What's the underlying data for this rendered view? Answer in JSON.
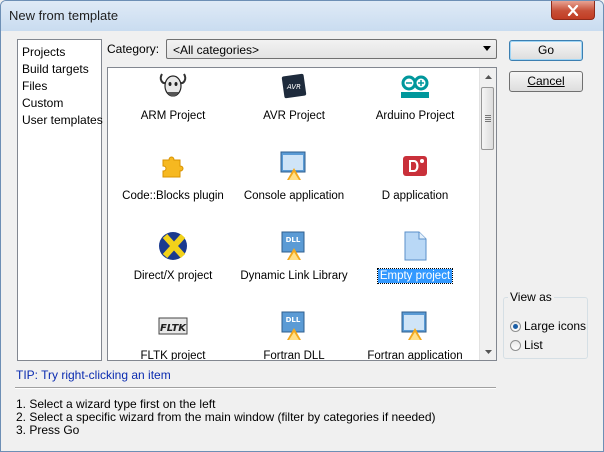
{
  "window": {
    "title": "New from template",
    "close_label": "×"
  },
  "sidebar": {
    "items": [
      {
        "label": "Projects"
      },
      {
        "label": "Build targets"
      },
      {
        "label": "Files"
      },
      {
        "label": "Custom"
      },
      {
        "label": "User templates"
      }
    ]
  },
  "category": {
    "label": "Category:",
    "value": "<All categories>"
  },
  "templates": [
    {
      "label": "ARM Project",
      "icon": "gnu-icon"
    },
    {
      "label": "AVR Project",
      "icon": "avr-chip-icon"
    },
    {
      "label": "Arduino Project",
      "icon": "arduino-icon"
    },
    {
      "label": "Code::Blocks plugin",
      "icon": "puzzle-icon"
    },
    {
      "label": "Console application",
      "icon": "console-app-icon"
    },
    {
      "label": "D application",
      "icon": "d-app-icon"
    },
    {
      "label": "Direct/X project",
      "icon": "directx-icon"
    },
    {
      "label": "Dynamic Link Library",
      "icon": "dll-icon"
    },
    {
      "label": "Empty project",
      "icon": "empty-file-icon",
      "selected": true
    },
    {
      "label": "FLTK project",
      "icon": "fltk-icon"
    },
    {
      "label": "Fortran DLL",
      "icon": "fortran-dll-icon"
    },
    {
      "label": "Fortran application",
      "icon": "fortran-app-icon"
    }
  ],
  "buttons": {
    "go": "Go",
    "cancel": "Cancel"
  },
  "view_as": {
    "title": "View as",
    "large_icons": "Large icons",
    "list": "List",
    "selected": "large_icons"
  },
  "tip": "TIP: Try right-clicking an item",
  "instructions": [
    "1. Select a wizard type first on the left",
    "2. Select a specific wizard from the main window (filter by categories if needed)",
    "3. Press Go"
  ],
  "colors": {
    "selection": "#3399ff",
    "tip_text": "#0a2bb0",
    "close_button": "#c74f37"
  }
}
